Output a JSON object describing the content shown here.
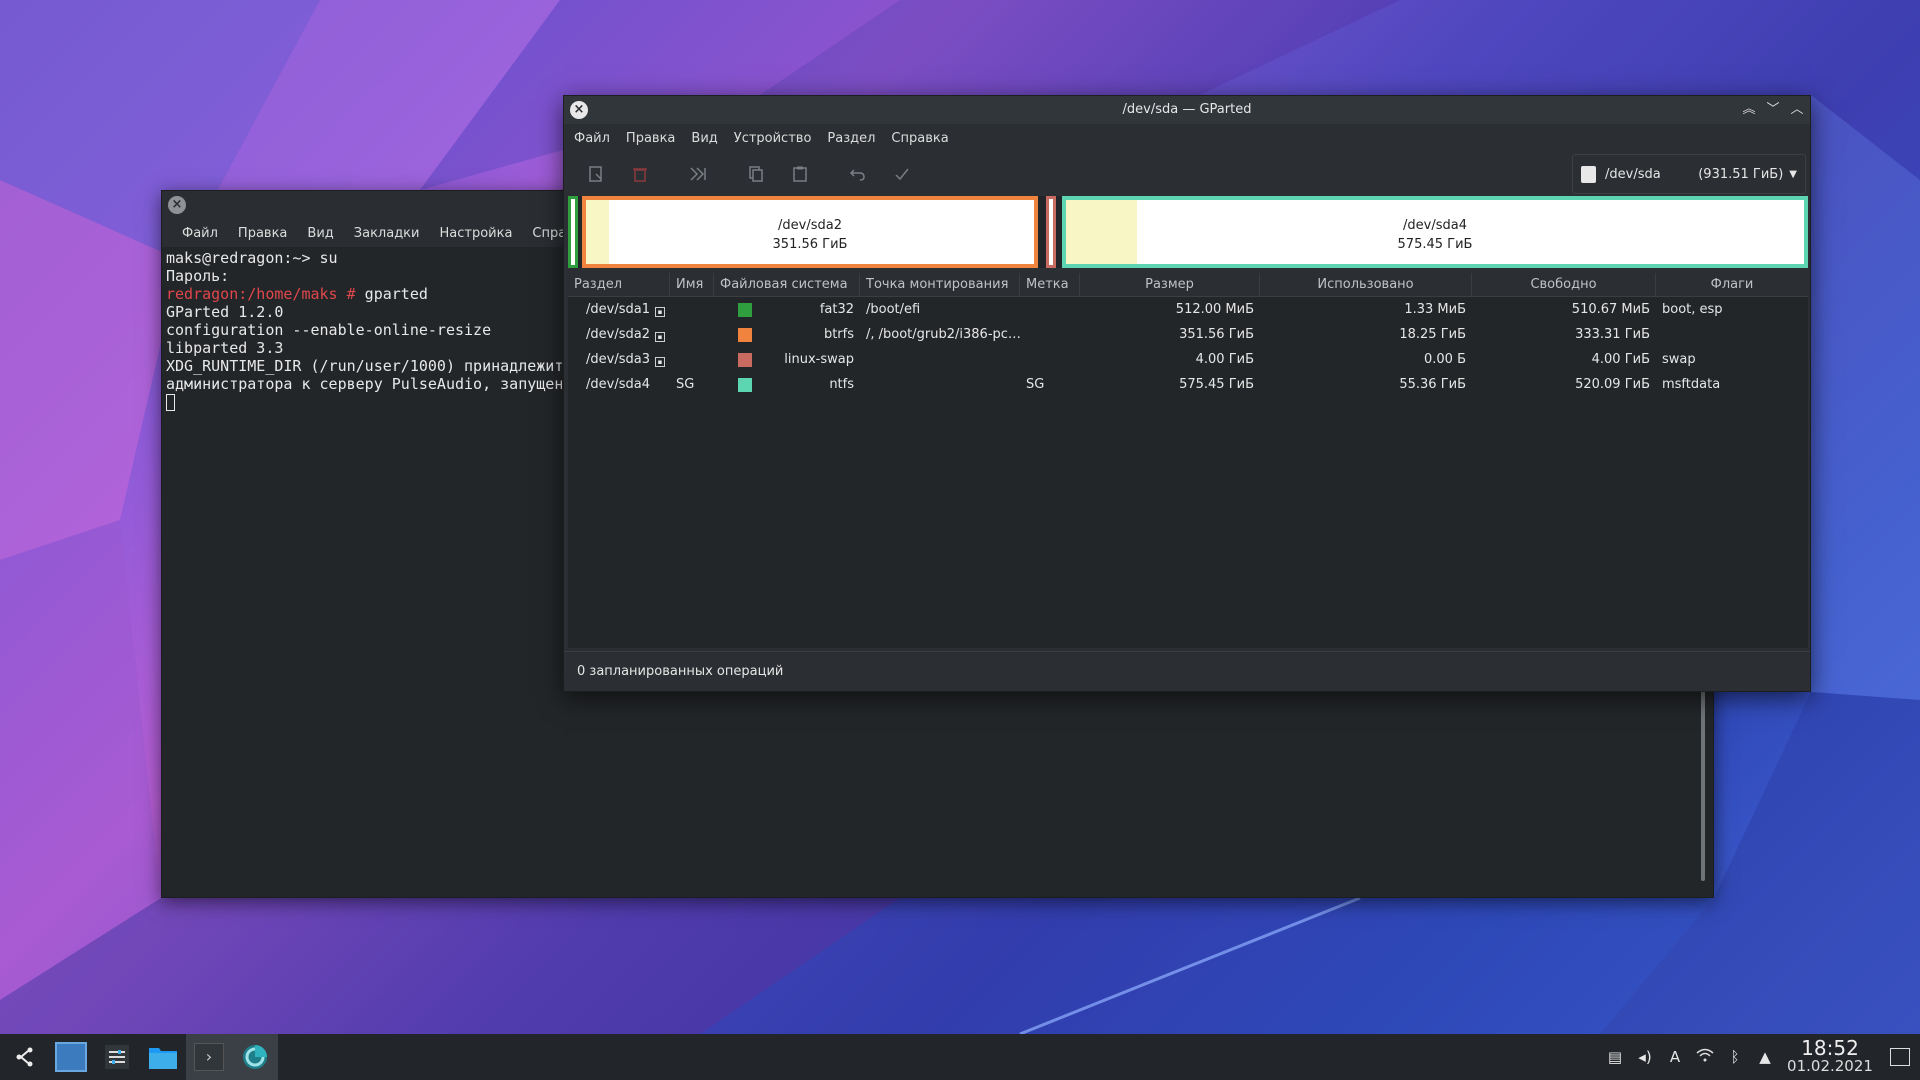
{
  "terminal": {
    "menu": [
      "Файл",
      "Правка",
      "Вид",
      "Закладки",
      "Настройка",
      "Справка"
    ],
    "lines": [
      {
        "type": "plain",
        "text": "maks@redragon:~> su"
      },
      {
        "type": "plain",
        "text": "Пароль:"
      },
      {
        "type": "prompt",
        "prompt": "redragon:/home/maks #",
        "cmd": " gparted"
      },
      {
        "type": "plain",
        "text": "GParted 1.2.0"
      },
      {
        "type": "plain",
        "text": "configuration --enable-online-resize"
      },
      {
        "type": "plain",
        "text": "libparted 3.3"
      },
      {
        "type": "plain",
        "text": "XDG_RUNTIME_DIR (/run/user/1000) принадлежит"
      },
      {
        "type": "plain",
        "text": "администратора к серверу PulseAudio, запущен"
      }
    ]
  },
  "gparted": {
    "title": "/dev/sda — GParted",
    "menu": [
      "Файл",
      "Правка",
      "Вид",
      "Устройство",
      "Раздел",
      "Справка"
    ],
    "toolbar_icons": [
      "new-partition-icon",
      "delete-icon",
      "resize-move-icon",
      "copy-icon",
      "paste-icon",
      "undo-icon",
      "apply-icon"
    ],
    "device": {
      "name": "/dev/sda",
      "size": "(931.51 ГиБ)"
    },
    "graph": {
      "sda2": {
        "name": "/dev/sda2",
        "size": "351.56 ГиБ",
        "used_fraction": 0.052
      },
      "sda4": {
        "name": "/dev/sda4",
        "size": "575.45 ГиБ",
        "used_fraction": 0.096
      }
    },
    "columns": [
      "Раздел",
      "Имя",
      "Файловая система",
      "Точка монтирования",
      "Метка",
      "Размер",
      "Использовано",
      "Свободно",
      "Флаги"
    ],
    "rows": [
      {
        "partition": "/dev/sda1",
        "locked": true,
        "name": "",
        "fs": "fat32",
        "fs_color": "#2f9e3f",
        "mount": "/boot/efi",
        "label": "",
        "size": "512.00 МиБ",
        "used": "1.33 МиБ",
        "free": "510.67 МиБ",
        "flags": "boot, esp"
      },
      {
        "partition": "/dev/sda2",
        "locked": true,
        "name": "",
        "fs": "btrfs",
        "fs_color": "#f0843e",
        "mount": "/, /boot/grub2/i386-pc…",
        "label": "",
        "size": "351.56 ГиБ",
        "used": "18.25 ГиБ",
        "free": "333.31 ГиБ",
        "flags": ""
      },
      {
        "partition": "/dev/sda3",
        "locked": true,
        "name": "",
        "fs": "linux-swap",
        "fs_color": "#c96b61",
        "mount": "",
        "label": "",
        "size": "4.00 ГиБ",
        "used": "0.00 Б",
        "free": "4.00 ГиБ",
        "flags": "swap"
      },
      {
        "partition": "/dev/sda4",
        "locked": false,
        "name": "SG",
        "fs": "ntfs",
        "fs_color": "#5cd6b0",
        "mount": "",
        "label": "SG",
        "size": "575.45 ГиБ",
        "used": "55.36 ГиБ",
        "free": "520.09 ГиБ",
        "flags": "msftdata"
      }
    ],
    "status": "0 запланированных операций"
  },
  "taskbar": {
    "items": [
      "launcher-icon",
      "desktop-pager-icon",
      "system-settings-icon",
      "file-manager-icon",
      "konsole-icon",
      "gparted-icon"
    ],
    "tray": [
      "clipboard-icon",
      "volume-icon",
      "keyboard-layout-icon",
      "wifi-icon",
      "bluetooth-icon",
      "tray-expand-icon"
    ],
    "keyboard_layout": "A",
    "time": "18:52",
    "date": "01.02.2021"
  }
}
